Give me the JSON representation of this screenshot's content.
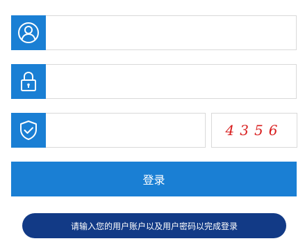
{
  "form": {
    "username": {
      "value": "",
      "placeholder": "",
      "icon": "user-icon"
    },
    "password": {
      "value": "",
      "placeholder": "",
      "icon": "lock-icon"
    },
    "verification": {
      "value": "",
      "placeholder": "",
      "icon": "shield-check-icon"
    },
    "captcha_code": "4356",
    "login_label": "登录",
    "hint_text": "请输入您的用户账户以及用户密码以完成登录"
  },
  "colors": {
    "primary": "#1a7fd4",
    "hint_background": "#123a86",
    "captcha_text": "#d81e1e",
    "border": "#d9d9d9"
  }
}
